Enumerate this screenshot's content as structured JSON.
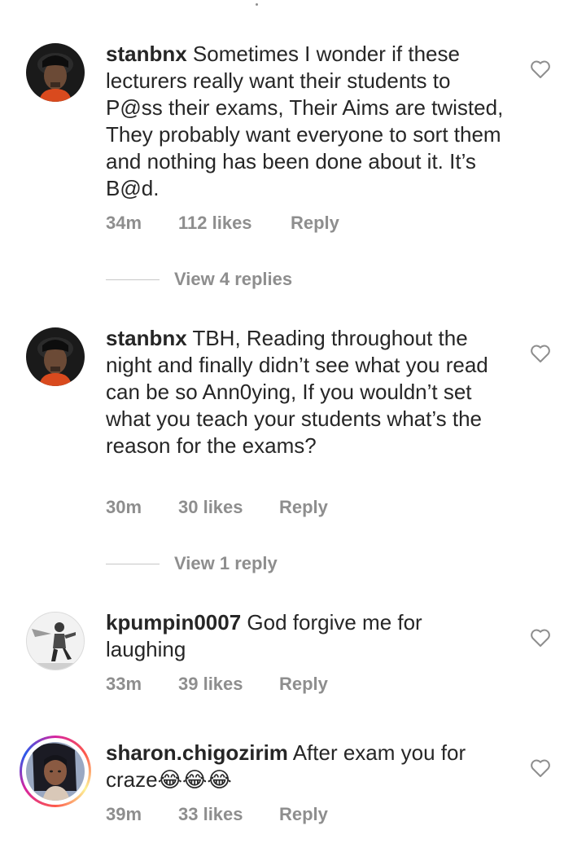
{
  "comments": [
    {
      "username": "stanbnx",
      "text": "Sometimes I wonder if these lecturers really want their students to P@ss their exams, Their Aims are twisted, They probably want everyone to sort them and nothing has been done about it. It’s B@d.",
      "time": "34m",
      "likes": "112 likes",
      "reply": "Reply",
      "view_replies": "View 4 replies",
      "avatar_icon": "profile-photo"
    },
    {
      "username": "stanbnx",
      "text": "TBH, Reading throughout the night and finally didn’t see what you read can be so Ann0ying, If you wouldn’t set what you teach your students what’s the reason for the exams?",
      "time": "30m",
      "likes": "30 likes",
      "reply": "Reply",
      "view_replies": "View 1 reply",
      "avatar_icon": "profile-photo"
    },
    {
      "username": "kpumpin0007",
      "text": "God forgive me for laughing",
      "time": "33m",
      "likes": "39 likes",
      "reply": "Reply",
      "avatar_icon": "profile-photo"
    },
    {
      "username": "sharon.chigozirim",
      "text": "After exam you for craze😂😂😂",
      "time": "39m",
      "likes": "33 likes",
      "reply": "Reply",
      "avatar_icon": "profile-photo-story-ring"
    }
  ],
  "icons": {
    "like": "heart-outline-icon"
  },
  "colors": {
    "text": "#262626",
    "muted": "#8e8e8e",
    "divider": "#c7c7c7"
  }
}
